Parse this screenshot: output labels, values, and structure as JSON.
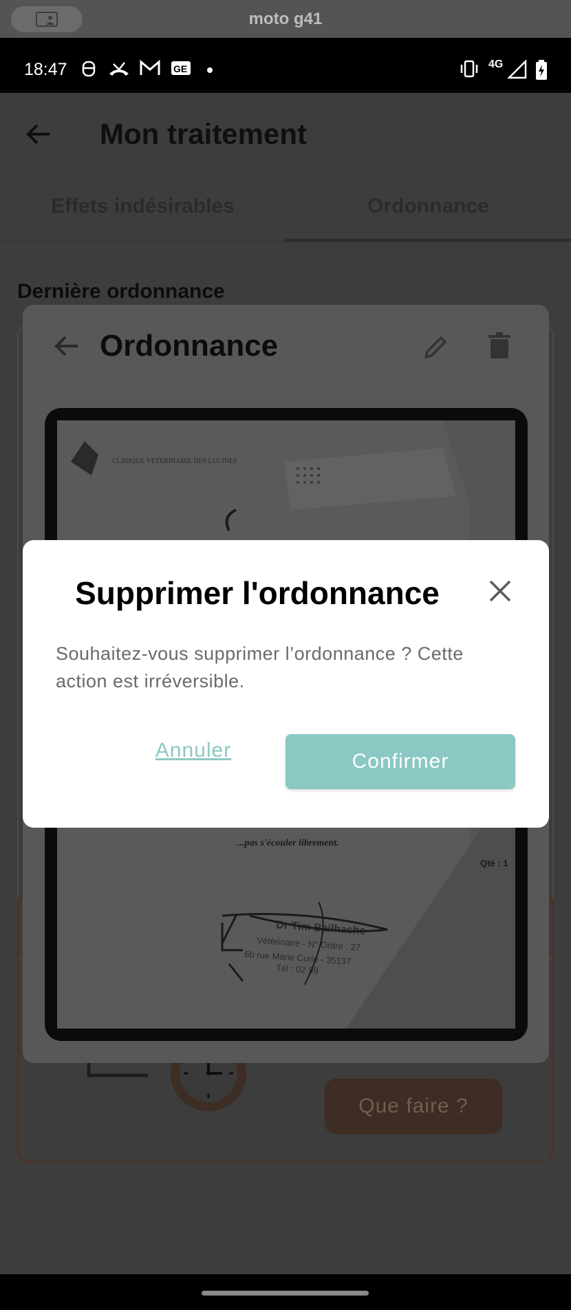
{
  "window": {
    "device_name": "moto g41"
  },
  "status_bar": {
    "time": "18:47",
    "notification_icons": [
      "face-icon",
      "missed-call-icon",
      "gmail-icon",
      "news-icon",
      "dot-icon"
    ],
    "network": "4G",
    "system_icons": [
      "vibrate-icon",
      "signal-icon",
      "battery-charging-icon"
    ]
  },
  "app_bar": {
    "title": "Mon traitement"
  },
  "tabs": [
    {
      "label": "Effets indésirables",
      "selected": false
    },
    {
      "label": "Ordonnance",
      "selected": true
    }
  ],
  "section": {
    "title": "Dernière ordonnance"
  },
  "warning_card": {
    "button_label": "Que faire ?",
    "accent": "#8b5a3c"
  },
  "ordonnance_sheet": {
    "title": "Ordonnance",
    "actions": [
      "edit-icon",
      "trash-icon"
    ],
    "photo_text": {
      "clinic": "CLINIQUE VETERINAIRE DES LUCINES",
      "instruction": "...pas s'écouler librement.",
      "qty": "Qté : 1",
      "doctor": "Dr Tim Bailhache",
      "doctor_line2": "Vétérinaire - N° Ordre : 27",
      "doctor_line3": "6b rue Marie Curie - 35137",
      "doctor_line4": "Tél : 02 99"
    }
  },
  "dialog": {
    "title": "Supprimer l'ordonnance",
    "body": "Souhaitez-vous supprimer l’ordonnance ? Cette action est irréversible.",
    "cancel_label": "Annuler",
    "confirm_label": "Confirmer",
    "accent": "#8bc8c3"
  }
}
